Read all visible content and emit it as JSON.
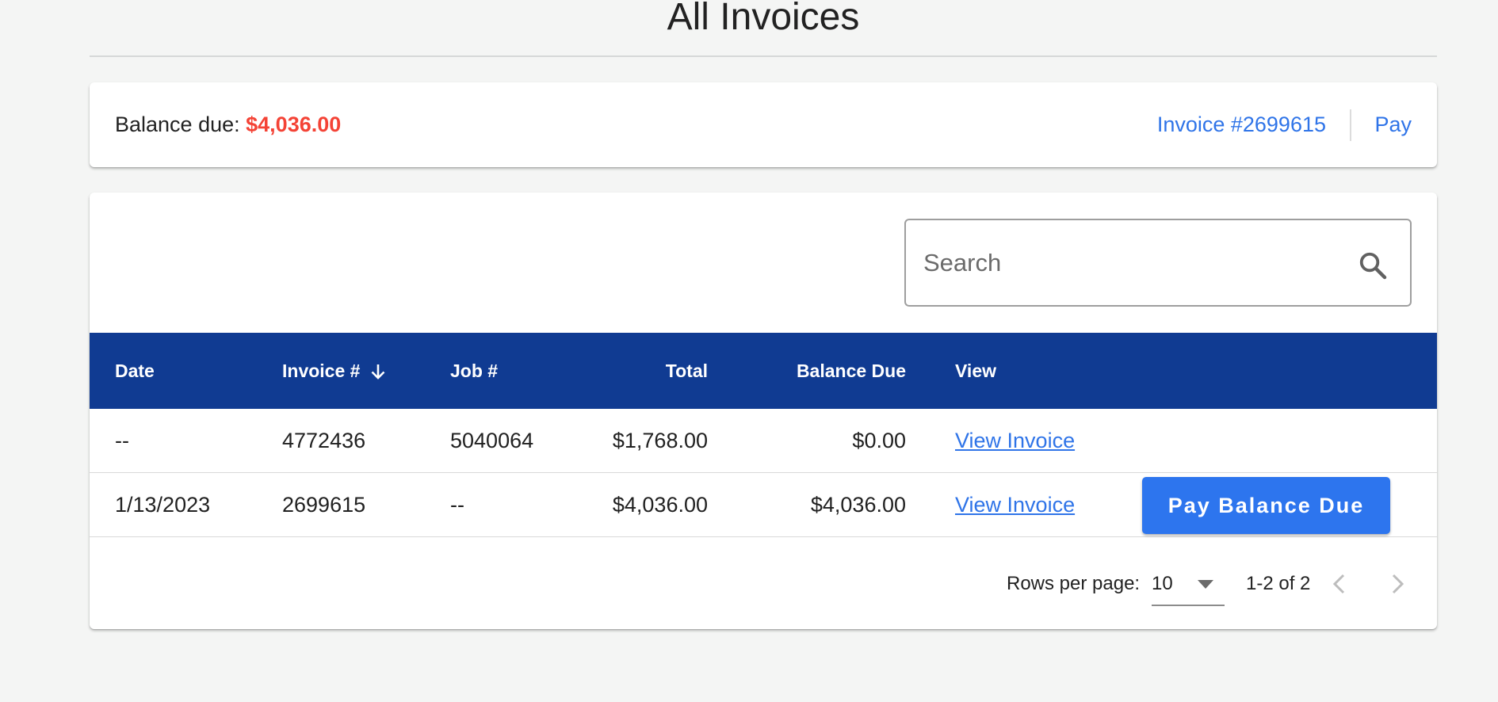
{
  "header": {
    "title": "All Invoices"
  },
  "balance": {
    "label": "Balance due:",
    "amount": "$4,036.00",
    "invoice_link": "Invoice #2699615",
    "pay_link": "Pay"
  },
  "search": {
    "placeholder": "Search",
    "value": ""
  },
  "table": {
    "columns": {
      "date": "Date",
      "invoice": "Invoice #",
      "job": "Job #",
      "total": "Total",
      "balance_due": "Balance Due",
      "view": "View"
    },
    "sort": {
      "column": "invoice",
      "direction": "descending"
    },
    "rows": [
      {
        "date": "--",
        "invoice": "4772436",
        "job": "5040064",
        "total": "$1,768.00",
        "balance_due": "$0.00",
        "view": "View Invoice"
      },
      {
        "date": "1/13/2023",
        "invoice": "2699615",
        "job": "--",
        "total": "$4,036.00",
        "balance_due": "$4,036.00",
        "view": "View Invoice",
        "action": "Pay Balance Due"
      }
    ]
  },
  "pagination": {
    "rows_per_page_label": "Rows per page:",
    "rows_per_page": "10",
    "range": "1-2 of 2"
  },
  "colors": {
    "header_bg": "#103b92",
    "accent": "#2d75ee",
    "link": "#2f74e8",
    "balance_amount": "#f44336",
    "page_bg": "#f4f5f4"
  }
}
